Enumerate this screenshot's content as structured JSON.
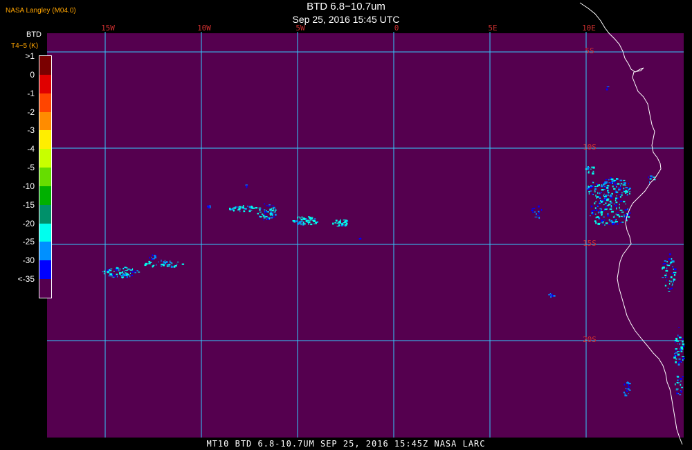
{
  "header": {
    "title": "BTD 6.8−10.7um",
    "subtitle": "Sep 25, 2016 15:45 UTC",
    "agency": "NASA Langley (M04.0)"
  },
  "legend": {
    "title": "BTD",
    "units": "T4−5 (K)",
    "entries": [
      {
        "label": ">1",
        "color": "#7a0000"
      },
      {
        "label": "0",
        "color": "#e00000"
      },
      {
        "label": "-1",
        "color": "#ff4500"
      },
      {
        "label": "-2",
        "color": "#ff8c00"
      },
      {
        "label": "-3",
        "color": "#ffee00"
      },
      {
        "label": "-4",
        "color": "#c8ff00"
      },
      {
        "label": "-5",
        "color": "#66dd00"
      },
      {
        "label": "-10",
        "color": "#00b000"
      },
      {
        "label": "-15",
        "color": "#00906a"
      },
      {
        "label": "-20",
        "color": "#00ffee"
      },
      {
        "label": "-25",
        "color": "#0090ff"
      },
      {
        "label": "-30",
        "color": "#0000ff"
      },
      {
        "label": "<-35",
        "color": "#55004f"
      }
    ]
  },
  "map": {
    "background_color": "#55004f",
    "grid_color": "#33ccff",
    "coastline_color": "#ffffff",
    "longitude_labels": [
      "15W",
      "10W",
      "5W",
      "0",
      "5E",
      "10E"
    ],
    "latitude_labels": [
      "5S",
      "10S",
      "15S",
      "20S"
    ]
  },
  "footer": "MT10  BTD 6.8-10.7UM  SEP 25, 2016 15:45Z  NASA LARC"
}
